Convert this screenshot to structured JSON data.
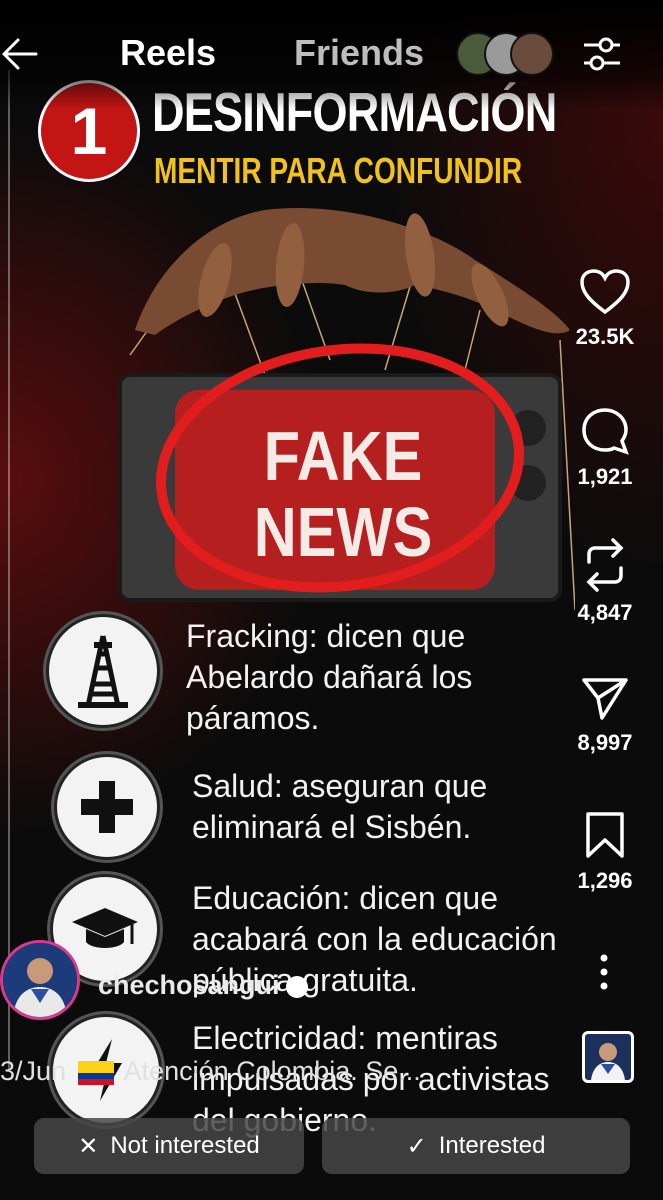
{
  "header": {
    "tab_reels": "Reels",
    "tab_friends": "Friends"
  },
  "post": {
    "number": "1",
    "headline": "DESINFORMACIÓN",
    "subheadline": "MENTIR PARA CONFUNDIR",
    "screen_text": "FAKE NEWS",
    "items": [
      {
        "label": "Fracking: dicen que Abelardo dañará los páramos.",
        "icon": "oil-rig-icon"
      },
      {
        "label": "Salud: aseguran que eliminará el Sisbén.",
        "icon": "medical-cross-icon"
      },
      {
        "label": "Educación: dicen que acabará con la educación pública gratuita.",
        "icon": "graduation-cap-icon"
      },
      {
        "label": "Electricidad: mentiras impulsadas por activistas del gobierno.",
        "icon": "lightning-bolt-icon"
      }
    ]
  },
  "actions": {
    "likes": "23.5K",
    "comments": "1,921",
    "reposts": "4,847",
    "shares": "8,997",
    "saves": "1,296"
  },
  "author": {
    "username": "chechosangui",
    "caption": "3/Jun",
    "caption_text": "Atención Colombia. Se..."
  },
  "buttons": {
    "not_interested": "Not interested",
    "interested": "Interested"
  },
  "colors": {
    "accent_red": "#c41515",
    "subhead_yellow": "#f1c21b"
  }
}
